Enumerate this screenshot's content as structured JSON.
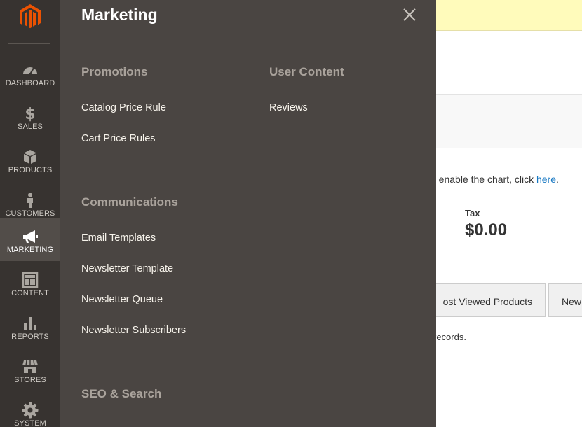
{
  "sidebar": {
    "logo": "magento-logo-icon",
    "items": [
      {
        "label": "DASHBOARD",
        "icon": "speedometer-icon",
        "active": false
      },
      {
        "label": "SALES",
        "icon": "dollar-icon",
        "active": false
      },
      {
        "label": "PRODUCTS",
        "icon": "cube-icon",
        "active": false
      },
      {
        "label": "CUSTOMERS",
        "icon": "person-icon",
        "active": false
      },
      {
        "label": "MARKETING",
        "icon": "megaphone-icon",
        "active": true
      },
      {
        "label": "CONTENT",
        "icon": "layout-icon",
        "active": false
      },
      {
        "label": "REPORTS",
        "icon": "bar-chart-icon",
        "active": false
      },
      {
        "label": "STORES",
        "icon": "storefront-icon",
        "active": false
      },
      {
        "label": "SYSTEM",
        "icon": "gear-icon",
        "active": false
      }
    ]
  },
  "flyout": {
    "title": "Marketing",
    "close_icon": "close-icon",
    "sections": {
      "promotions": {
        "title": "Promotions",
        "links": [
          "Catalog Price Rule",
          "Cart Price Rules"
        ]
      },
      "user_content": {
        "title": "User Content",
        "links": [
          "Reviews"
        ]
      },
      "communications": {
        "title": "Communications",
        "links": [
          "Email Templates",
          "Newsletter Template",
          "Newsletter Queue",
          "Newsletter Subscribers"
        ]
      },
      "seo": {
        "title": "SEO & Search"
      }
    }
  },
  "background": {
    "chart_msg_prefix": "o enable the chart, click ",
    "chart_msg_link": "here",
    "chart_msg_suffix": ".",
    "tax_label": "Tax",
    "tax_value": "$0.00",
    "tabs": [
      "ost Viewed Products",
      "New"
    ],
    "records_text": "records."
  },
  "colors": {
    "sidebar_bg": "#373330",
    "sidebar_active": "#524d49",
    "flyout_bg": "#4a4542",
    "brand_orange": "#eb5202",
    "notice_yellow": "#fffbbb",
    "link_blue": "#1979c3"
  }
}
